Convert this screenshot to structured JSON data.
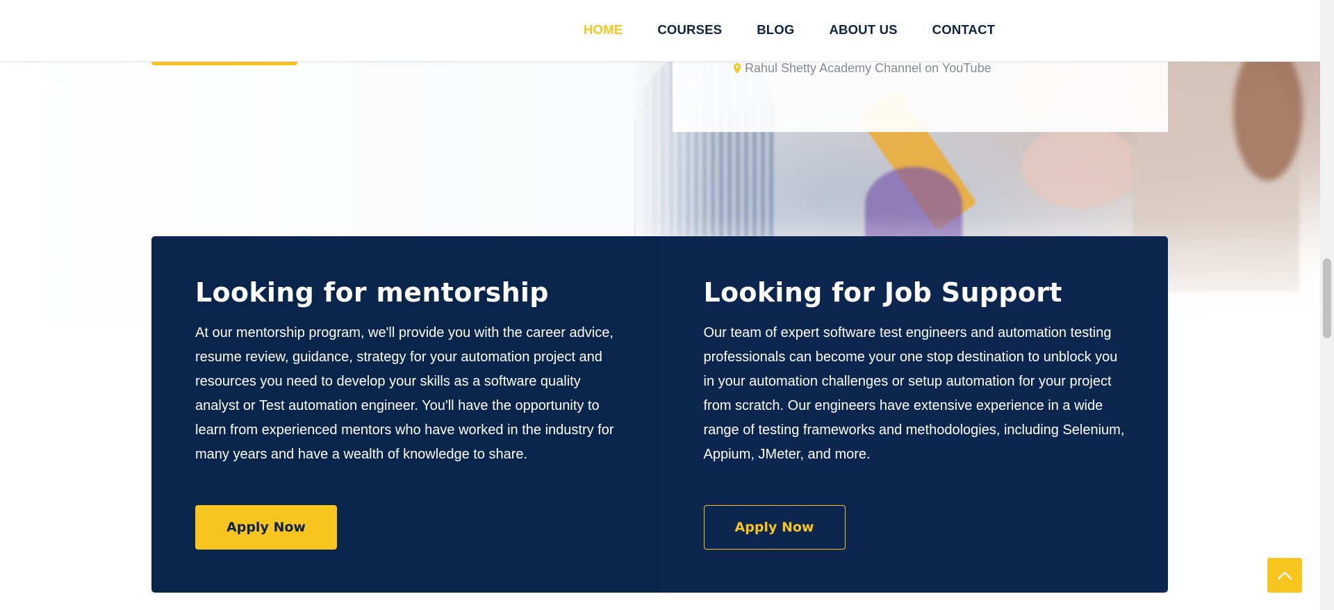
{
  "nav": {
    "items": [
      {
        "label": "HOME",
        "active": true
      },
      {
        "label": "COURSES",
        "active": false
      },
      {
        "label": "BLOG",
        "active": false
      },
      {
        "label": "ABOUT US",
        "active": false
      },
      {
        "label": "CONTACT",
        "active": false
      }
    ]
  },
  "hero": {
    "info_line": "Rahul Shetty Academy Channel on YouTube",
    "icon": "map-marker-icon"
  },
  "cards": [
    {
      "title": "Looking for mentorship",
      "text": "At our mentorship program, we'll provide you with the career advice, resume review, guidance, strategy for your automation project and resources you need to develop your skills as a software quality analyst or Test automation engineer. You'll have the opportunity to learn from experienced mentors who have worked in the industry for many years and have a wealth of knowledge to share.",
      "button_label": "Apply Now"
    },
    {
      "title": "Looking for Job Support",
      "text": "Our team of expert software test engineers and automation testing professionals can become your one stop destination to unblock you in your automation challenges or setup automation for your project from scratch. Our engineers have extensive experience in a wide range of testing frameworks and methodologies, including Selenium, Appium, JMeter, and more.",
      "button_label": "Apply Now"
    }
  ],
  "colors": {
    "accent": "#f8c51f",
    "navy": "#0a254b",
    "nav_text": "#0d2344"
  },
  "back_to_top_icon": "chevron-up-icon"
}
